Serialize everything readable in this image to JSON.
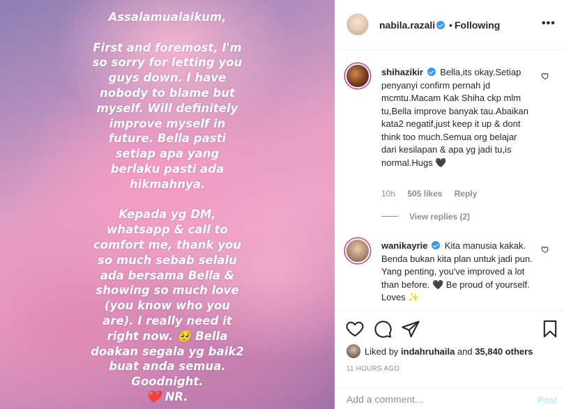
{
  "post": {
    "image_text_lines": [
      "Assalamualaikum,",
      "",
      "First and foremost, I'm",
      "so sorry for letting you",
      "guys down. I have",
      "nobody to blame but",
      "myself. Will definitely",
      "improve myself in",
      "future. Bella pasti",
      "setiap apa yang",
      "berlaku pasti ada",
      "hikmahnya.",
      "",
      "Kepada yg DM,",
      "whatsapp & call to",
      "comfort me, thank you",
      "so much sebab selalu",
      "ada bersama Bella &",
      "showing so much love",
      "(you know who you",
      "are). I really need it",
      "right now. 🥺 Bella",
      "doakan segala yg baik2",
      "buat anda semua.",
      "Goodnight.",
      "❤️ NR."
    ]
  },
  "header": {
    "username": "nabila.razali",
    "separator": "•",
    "follow_status": "Following",
    "more_label": "•••"
  },
  "comments": [
    {
      "username": "shihazikir",
      "text": "Bella,its okay.Setiap penyanyi confirm pernah jd mcmtu.Macam Kak Shiha ckp mlm tu,Bella improve banyak tau.Abaikan kata2 negatif,just keep it up & dont think too much.Semua org belajar dari kesilapan & apa yg jadi tu,is normal.Hugs 🖤",
      "time": "10h",
      "likes": "505 likes",
      "reply_label": "Reply",
      "view_replies": "View replies (2)"
    },
    {
      "username": "wanikayrie",
      "text": "Kita manusia kakak. Benda bukan kita plan untuk jadi pun. Yang penting, you've improved a lot than before. 🖤 Be proud of yourself. Loves ✨"
    }
  ],
  "actions": {
    "liked_by_prefix": "Liked by",
    "liked_by_user": "indahruhaila",
    "liked_by_and": "and",
    "liked_by_count": "35,840 others",
    "timestamp": "11 HOURS AGO"
  },
  "add_comment": {
    "placeholder": "Add a comment...",
    "post_label": "Post"
  },
  "colors": {
    "link_blue": "#3897f0",
    "post_disabled": "#b2dffc",
    "muted": "#8e8e8e",
    "story_ring": "#c13584"
  },
  "icons": [
    "verified-badge-icon",
    "heart-icon",
    "comment-icon",
    "share-icon",
    "bookmark-icon"
  ]
}
